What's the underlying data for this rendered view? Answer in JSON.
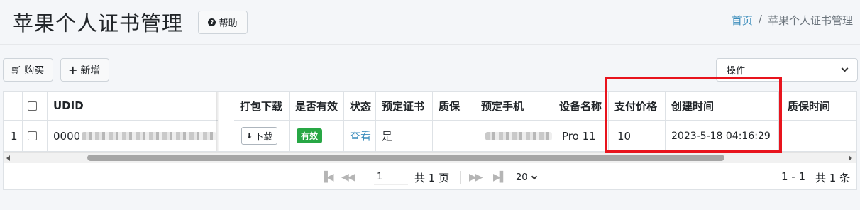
{
  "header": {
    "title": "苹果个人证书管理",
    "help_label": "帮助",
    "breadcrumb_home": "首页",
    "breadcrumb_sep": "/",
    "breadcrumb_current": "苹果个人证书管理"
  },
  "toolbar": {
    "buy_label": "购买",
    "add_label": "新增",
    "ops_selected": "操作"
  },
  "table": {
    "columns": [
      "UDID",
      "打包下载",
      "是否有效",
      "状态",
      "预定证书",
      "质保",
      "预定手机",
      "设备名称",
      "支付价格",
      "创建时间",
      "质保时间"
    ],
    "rows": [
      {
        "index": "1",
        "udid": "0000",
        "download_label": "下载",
        "valid": "有效",
        "status": "查看",
        "reserved_cert": "是",
        "warranty": "",
        "device_name": "Pro 11",
        "price": "10",
        "created_at": "2023-5-18 04:16:29",
        "warranty_time": ""
      }
    ]
  },
  "pager": {
    "page_input": "1",
    "total_pages_text": "共 1 页",
    "page_size": "20",
    "range_text": "1 - 1",
    "total_text": "共 1 条"
  },
  "colors": {
    "link": "#3c8dbc",
    "badge_green": "#28a745",
    "highlight_red": "#e8141d"
  }
}
